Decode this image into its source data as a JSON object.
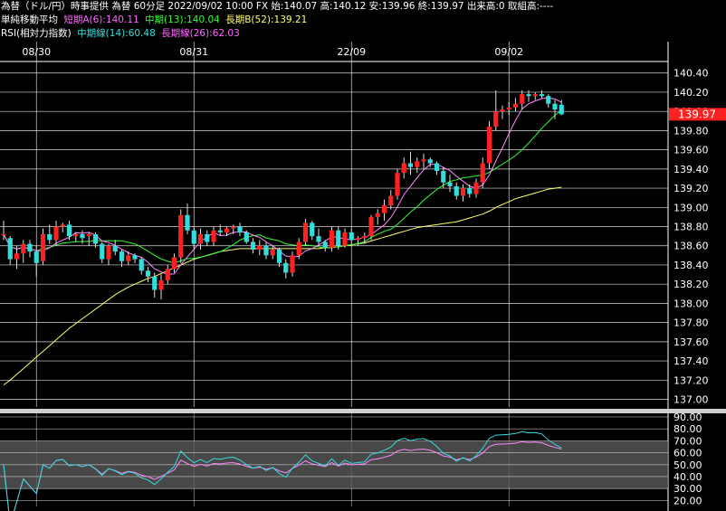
{
  "header": {
    "line1": "為替（ドル/円）時事提供 為替 60分足 2022/09/02 10:00 FX 始:140.07 高:140.12 安:139.96 終:139.97 出来高:0 取組高:----",
    "ma_title": "単純移動平均",
    "ma_short": "短期A(6):140.11",
    "ma_mid": "中期(13):140.04",
    "ma_long": "長期B(52):139.21",
    "rsi_title": "RSI(相対力指数)",
    "rsi_mid": "中期線(14):60.48",
    "rsi_long": "長期線(26):62.03"
  },
  "colors": {
    "up": "#ff2020",
    "down": "#33dddd",
    "ma_short": "#ff88ff",
    "ma_mid": "#33ff33",
    "ma_long": "#ffff66",
    "rsi_mid": "#33dddd",
    "rsi_long": "#ff88ff",
    "grid": "#ffffff",
    "badge_bg": "#ff2020"
  },
  "chart_data": [
    {
      "type": "candlestick",
      "x_labels": [
        {
          "label": "08/30",
          "index": 5
        },
        {
          "label": "08/31",
          "index": 29
        },
        {
          "label": "22/09",
          "index": 53
        },
        {
          "label": "09/02",
          "index": 77
        }
      ],
      "yticks": [
        140.4,
        140.2,
        140.0,
        139.8,
        139.6,
        139.4,
        139.2,
        139.0,
        138.8,
        138.6,
        138.4,
        138.2,
        138.0,
        137.8,
        137.6,
        137.4,
        137.2,
        137.0
      ],
      "ylim": [
        136.92,
        140.52
      ],
      "last_price": "139.97",
      "ohlc": [
        [
          138.72,
          138.86,
          138.66,
          138.72
        ],
        [
          138.68,
          138.7,
          138.4,
          138.46
        ],
        [
          138.46,
          138.6,
          138.36,
          138.52
        ],
        [
          138.52,
          138.66,
          138.42,
          138.62
        ],
        [
          138.62,
          138.66,
          138.48,
          138.54
        ],
        [
          138.54,
          138.6,
          138.28,
          138.42
        ],
        [
          138.44,
          138.78,
          138.4,
          138.72
        ],
        [
          138.72,
          138.82,
          138.62,
          138.66
        ],
        [
          138.66,
          138.86,
          138.6,
          138.8
        ],
        [
          138.8,
          138.84,
          138.74,
          138.82
        ],
        [
          138.82,
          138.86,
          138.66,
          138.7
        ],
        [
          138.7,
          138.74,
          138.64,
          138.72
        ],
        [
          138.72,
          138.76,
          138.62,
          138.68
        ],
        [
          138.7,
          138.74,
          138.6,
          138.72
        ],
        [
          138.72,
          138.74,
          138.58,
          138.62
        ],
        [
          138.62,
          138.64,
          138.42,
          138.46
        ],
        [
          138.46,
          138.62,
          138.4,
          138.6
        ],
        [
          138.6,
          138.66,
          138.5,
          138.54
        ],
        [
          138.54,
          138.56,
          138.38,
          138.44
        ],
        [
          138.44,
          138.54,
          138.4,
          138.5
        ],
        [
          138.5,
          138.52,
          138.42,
          138.46
        ],
        [
          138.46,
          138.48,
          138.3,
          138.34
        ],
        [
          138.34,
          138.38,
          138.22,
          138.28
        ],
        [
          138.28,
          138.32,
          138.06,
          138.14
        ],
        [
          138.14,
          138.3,
          138.04,
          138.24
        ],
        [
          138.24,
          138.4,
          138.2,
          138.36
        ],
        [
          138.36,
          138.52,
          138.32,
          138.48
        ],
        [
          138.48,
          138.98,
          138.42,
          138.92
        ],
        [
          138.92,
          139.04,
          138.72,
          138.76
        ],
        [
          138.76,
          138.8,
          138.56,
          138.62
        ],
        [
          138.62,
          138.78,
          138.56,
          138.72
        ],
        [
          138.72,
          138.76,
          138.6,
          138.64
        ],
        [
          138.64,
          138.8,
          138.6,
          138.76
        ],
        [
          138.76,
          138.82,
          138.7,
          138.74
        ],
        [
          138.74,
          138.8,
          138.7,
          138.78
        ],
        [
          138.78,
          138.82,
          138.72,
          138.8
        ],
        [
          138.8,
          138.84,
          138.7,
          138.74
        ],
        [
          138.74,
          138.76,
          138.62,
          138.64
        ],
        [
          138.64,
          138.68,
          138.52,
          138.56
        ],
        [
          138.56,
          138.66,
          138.5,
          138.6
        ],
        [
          138.6,
          138.64,
          138.46,
          138.5
        ],
        [
          138.5,
          138.6,
          138.46,
          138.56
        ],
        [
          138.56,
          138.58,
          138.38,
          138.42
        ],
        [
          138.42,
          138.46,
          138.26,
          138.32
        ],
        [
          138.32,
          138.54,
          138.28,
          138.5
        ],
        [
          138.5,
          138.68,
          138.46,
          138.64
        ],
        [
          138.64,
          138.88,
          138.6,
          138.84
        ],
        [
          138.84,
          138.86,
          138.66,
          138.7
        ],
        [
          138.7,
          138.78,
          138.6,
          138.64
        ],
        [
          138.64,
          138.66,
          138.54,
          138.58
        ],
        [
          138.58,
          138.8,
          138.54,
          138.76
        ],
        [
          138.76,
          138.8,
          138.56,
          138.6
        ],
        [
          138.6,
          138.78,
          138.58,
          138.74
        ],
        [
          138.74,
          138.78,
          138.62,
          138.66
        ],
        [
          138.66,
          138.7,
          138.6,
          138.68
        ],
        [
          138.68,
          138.74,
          138.62,
          138.7
        ],
        [
          138.7,
          138.92,
          138.66,
          138.9
        ],
        [
          138.9,
          138.98,
          138.82,
          138.94
        ],
        [
          138.94,
          139.08,
          138.86,
          139.02
        ],
        [
          139.02,
          139.18,
          138.98,
          139.12
        ],
        [
          139.12,
          139.4,
          139.08,
          139.36
        ],
        [
          139.36,
          139.52,
          139.3,
          139.46
        ],
        [
          139.46,
          139.58,
          139.34,
          139.42
        ],
        [
          139.42,
          139.52,
          139.36,
          139.48
        ],
        [
          139.48,
          139.56,
          139.4,
          139.5
        ],
        [
          139.5,
          139.52,
          139.42,
          139.46
        ],
        [
          139.46,
          139.48,
          139.34,
          139.38
        ],
        [
          139.38,
          139.42,
          139.2,
          139.26
        ],
        [
          139.26,
          139.34,
          139.16,
          139.22
        ],
        [
          139.22,
          139.26,
          139.08,
          139.12
        ],
        [
          139.12,
          139.24,
          139.06,
          139.2
        ],
        [
          139.2,
          139.24,
          139.1,
          139.14
        ],
        [
          139.14,
          139.3,
          139.1,
          139.26
        ],
        [
          139.26,
          139.52,
          139.2,
          139.46
        ],
        [
          139.46,
          139.9,
          139.4,
          139.84
        ],
        [
          139.84,
          140.22,
          139.8,
          140.0
        ],
        [
          140.0,
          140.06,
          139.92,
          140.02
        ],
        [
          140.02,
          140.1,
          139.96,
          140.04
        ],
        [
          140.04,
          140.14,
          140.0,
          140.08
        ],
        [
          140.08,
          140.22,
          140.02,
          140.18
        ],
        [
          140.18,
          140.22,
          140.1,
          140.16
        ],
        [
          140.16,
          140.2,
          140.12,
          140.18
        ],
        [
          140.18,
          140.22,
          140.14,
          140.16
        ],
        [
          140.16,
          140.18,
          140.04,
          140.08
        ],
        [
          140.08,
          140.12,
          139.92,
          140.02
        ],
        [
          140.07,
          140.12,
          139.96,
          139.97
        ]
      ],
      "ma_long_series": [
        137.15,
        137.2,
        137.26,
        137.32,
        137.38,
        137.44,
        137.5,
        137.56,
        137.62,
        137.68,
        137.74,
        137.79,
        137.84,
        137.89,
        137.94,
        137.99,
        138.04,
        138.09,
        138.13,
        138.17,
        138.2,
        138.23,
        138.26,
        138.28,
        138.31,
        138.34,
        138.37,
        138.4,
        138.43,
        138.46,
        138.48,
        138.5,
        138.52,
        138.54,
        138.55,
        138.56,
        138.57,
        138.57,
        138.57,
        138.57,
        138.57,
        138.57,
        138.57,
        138.57,
        138.57,
        138.57,
        138.57,
        138.57,
        138.57,
        138.58,
        138.58,
        138.59,
        138.6,
        138.61,
        138.62,
        138.63,
        138.65,
        138.67,
        138.69,
        138.71,
        138.73,
        138.75,
        138.77,
        138.79,
        138.8,
        138.81,
        138.82,
        138.83,
        138.84,
        138.85,
        138.87,
        138.89,
        138.91,
        138.93,
        138.96,
        139.0,
        139.03,
        139.06,
        139.09,
        139.11,
        139.13,
        139.15,
        139.17,
        139.19,
        139.2,
        139.21
      ]
    },
    {
      "type": "line",
      "yticks": [
        90.0,
        80.0,
        70.0,
        60.0,
        50.0,
        40.0,
        30.0,
        20.0
      ],
      "ylim": [
        15,
        93
      ],
      "band": [
        30,
        70
      ]
    }
  ]
}
